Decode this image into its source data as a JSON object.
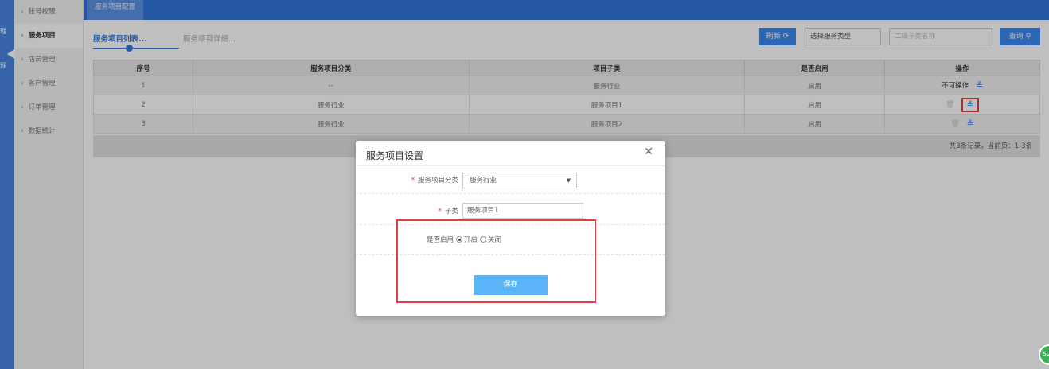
{
  "leftstrip": {
    "labels": [
      "理",
      "理"
    ]
  },
  "sidebar": {
    "items": [
      {
        "label": "账号权限"
      },
      {
        "label": "服务项目"
      },
      {
        "label": "店员管理"
      },
      {
        "label": "客户管理"
      },
      {
        "label": "订单管理"
      },
      {
        "label": "数据统计"
      }
    ]
  },
  "topbar": {
    "tab": "服务项目配置"
  },
  "subtabs": {
    "active": "服务项目列表...",
    "inactive": "服务项目详细..."
  },
  "toolbar": {
    "refresh_label": "刷新",
    "service_type_placeholder": "选择服务类型",
    "subcategory_placeholder": "二级子类名称",
    "query_label": "查询"
  },
  "table": {
    "headers": [
      "序号",
      "服务项目分类",
      "项目子类",
      "是否启用",
      "操作"
    ],
    "rows": [
      {
        "no": "1",
        "category": "--",
        "subcategory": "服务行业",
        "enabled": "启用",
        "op_text": "不可操作"
      },
      {
        "no": "2",
        "category": "服务行业",
        "subcategory": "服务项目1",
        "enabled": "启用",
        "op_text": ""
      },
      {
        "no": "3",
        "category": "服务行业",
        "subcategory": "服务项目2",
        "enabled": "启用",
        "op_text": ""
      }
    ],
    "footer": "共3条记录，当前页：1-3条"
  },
  "modal": {
    "title": "服务项目设置",
    "category_label": "服务项目分类",
    "category_value": "服务行业",
    "sub_label": "子类",
    "sub_value": "服务项目1",
    "enabled_label": "是否启用",
    "option_on": "开启",
    "option_off": "关闭",
    "save_label": "保存"
  },
  "badge": {
    "text": "52"
  }
}
